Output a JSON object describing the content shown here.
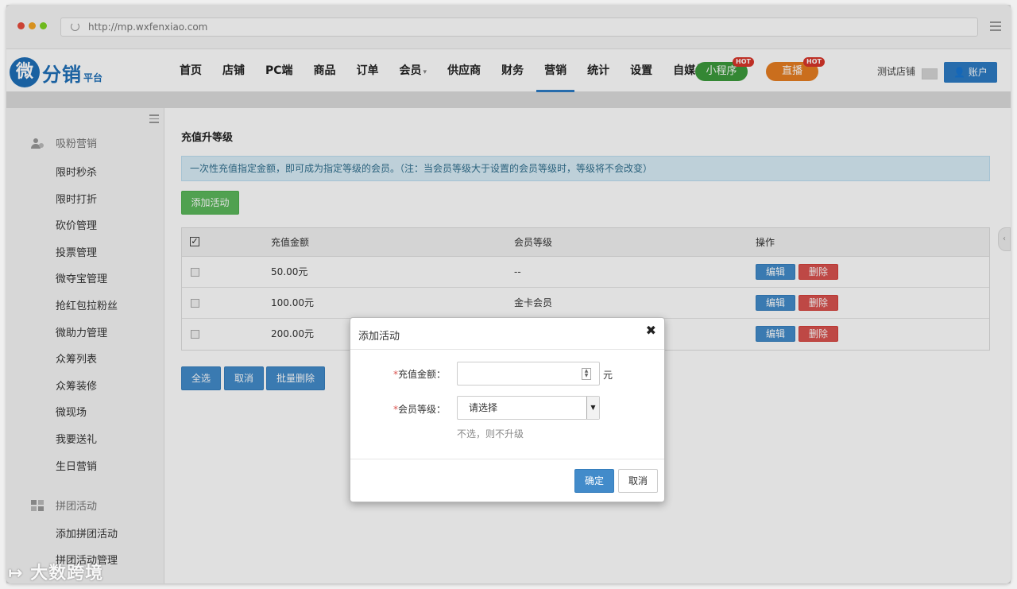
{
  "browser": {
    "url": "http://mp.wxfenxiao.com",
    "dot_colors": [
      "#e74c3c",
      "#f5a623",
      "#7ed321"
    ]
  },
  "logo": {
    "mark": "微",
    "text": "分销",
    "sub": "平台"
  },
  "nav": {
    "items": [
      "首页",
      "店铺",
      "PC端",
      "商品",
      "订单",
      "会员",
      "供应商",
      "财务",
      "营销",
      "统计",
      "设置",
      "自媒体"
    ],
    "active": "营销",
    "member_caret": "▾",
    "miniapp": "小程序",
    "live": "直播",
    "hot": "HOT",
    "store": "测试店铺",
    "account": "账户",
    "account_icon": "user-icon"
  },
  "sidebar": {
    "section1": "吸粉营销",
    "items1": [
      "限时秒杀",
      "限时打折",
      "砍价管理",
      "投票管理",
      "微夺宝管理",
      "抢红包拉粉丝",
      "微助力管理",
      "众筹列表",
      "众筹装修",
      "微现场",
      "我要送礼",
      "生日营销"
    ],
    "section2": "拼团活动",
    "items2": [
      "添加拼团活动",
      "拼团活动管理"
    ]
  },
  "main": {
    "title": "充值升等级",
    "notice": "一次性充值指定金额，即可成为指定等级的会员。（注：当会员等级大于设置的会员等级时，等级将不会改变）",
    "add_button": "添加活动",
    "table": {
      "headers": [
        "充值金额",
        "会员等级",
        "操作"
      ],
      "rows": [
        {
          "amount": "50.00元",
          "level": "--"
        },
        {
          "amount": "100.00元",
          "level": "金卡会员"
        },
        {
          "amount": "200.00元",
          "level": ""
        }
      ],
      "edit": "编辑",
      "delete": "删除"
    },
    "select_all": "全选",
    "cancel": "取消",
    "batch_delete": "批量删除"
  },
  "modal": {
    "title": "添加活动",
    "close": "✖",
    "req": "*",
    "amount_label": "充值金额：",
    "amount_value": "",
    "unit": "元",
    "level_label": "会员等级：",
    "level_value": "请选择",
    "hint": "不选，则不升级",
    "confirm": "确定",
    "cancel": "取消"
  },
  "watermark": "大数跨境"
}
